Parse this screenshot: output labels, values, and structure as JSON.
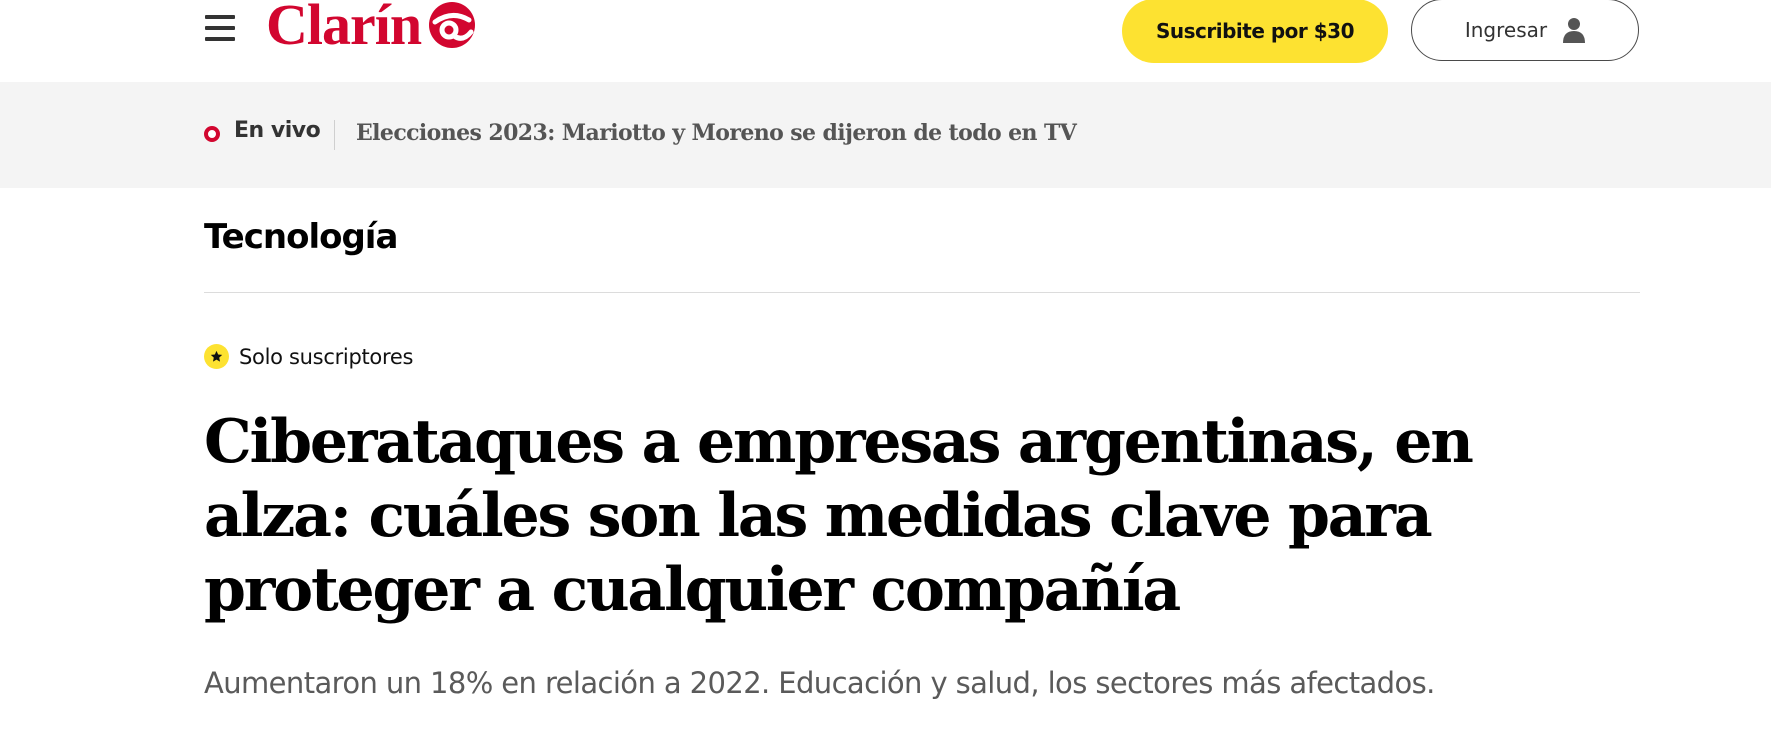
{
  "header": {
    "menu_icon": "hamburger-menu-icon",
    "logo_text": "Clarín",
    "logo_mark_icon": "clarin-gaucho-mark-icon",
    "subscribe_label": "Suscribite por $30",
    "login_label": "Ingresar",
    "login_icon": "user-icon"
  },
  "live": {
    "indicator_icon": "live-dot-icon",
    "label": "En vivo",
    "headline": "Elecciones 2023: Mariotto y Moreno se dijeron de todo en TV"
  },
  "section": {
    "title": "Tecnología"
  },
  "article": {
    "badge_icon": "star-icon",
    "badge_label": "Solo suscriptores",
    "headline": "Ciberataques a empresas argentinas, en alza: cuáles son las medidas clave para proteger a cualquier compañía",
    "subheadline": "Aumentaron un 18% en relación a 2022. Educación y salud, los sectores más afectados."
  },
  "colors": {
    "brand_red": "#d2062f",
    "subscribe_yellow": "#fde231",
    "live_bar_bg": "#f4f4f4",
    "text_dark": "#000000",
    "text_gray": "#5a5a5a"
  }
}
